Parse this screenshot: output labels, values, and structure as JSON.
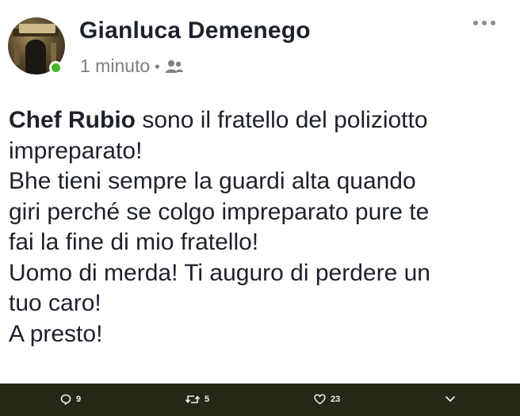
{
  "post": {
    "author": "Gianluca Demenego",
    "timestamp": "1 minuto",
    "separator": "•",
    "audience_icon": "friends-icon",
    "more_icon": "more-icon",
    "online_color": "#42b72a",
    "text_mention": "Chef Rubio",
    "text_body": " sono il fratello del poliziotto\nimpreparato!\nBhe tieni sempre la guardi alta quando\ngiri perché se colgo impreparato pure te\nfai la fine di mio fratello!\nUomo di merda! Ti auguro di perdere un\ntuo caro!\nA presto!"
  },
  "actions": {
    "reply_count": "9",
    "retweet_count": "5",
    "like_count": "23",
    "reply_icon": "reply-icon",
    "retweet_icon": "retweet-icon",
    "like_icon": "heart-icon",
    "menu_icon": "chevron-down-icon"
  },
  "colors": {
    "action_bar_bg": "#272718",
    "text": "#1d2129",
    "meta": "#7f7f7f"
  }
}
